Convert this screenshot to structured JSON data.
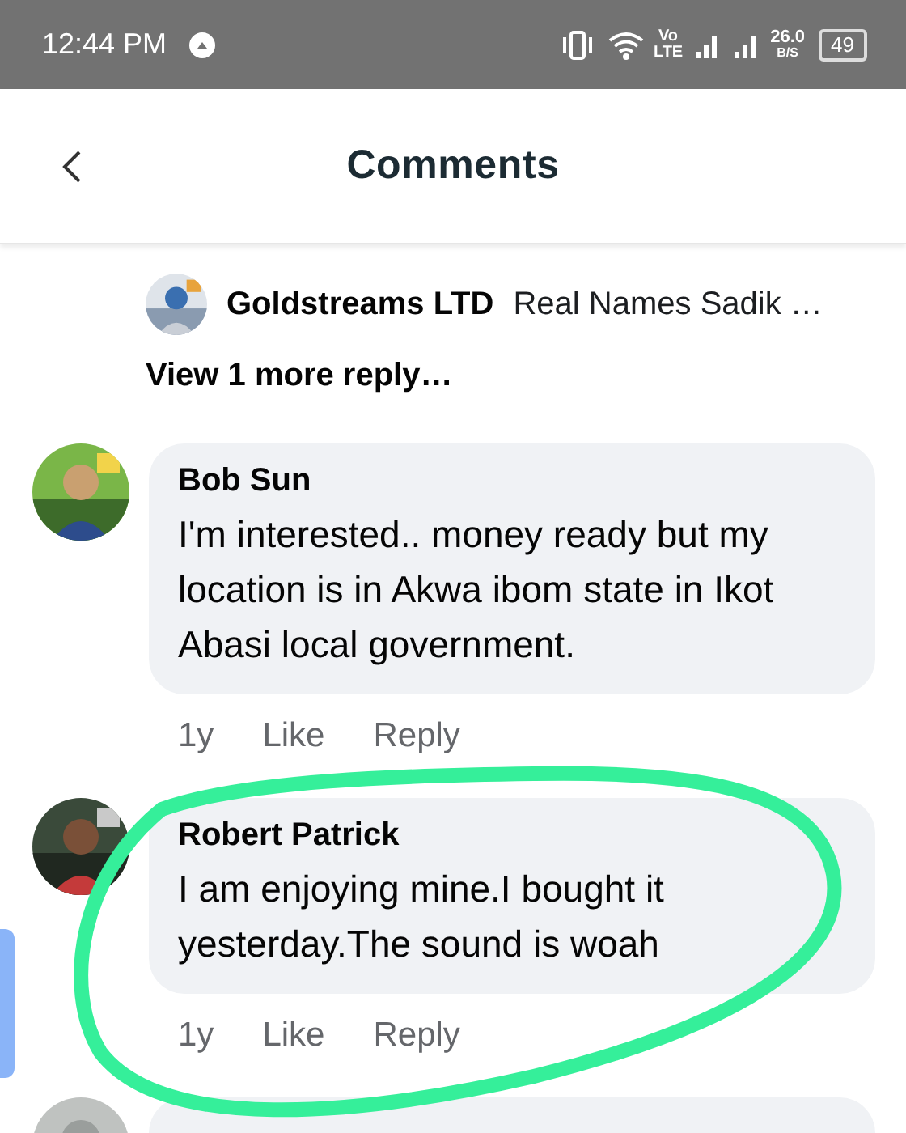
{
  "status_bar": {
    "time": "12:44 PM",
    "volte_top": "Vo",
    "volte_bottom": "LTE",
    "speed": "26.0",
    "speed_unit": "B/S",
    "battery": "49"
  },
  "header": {
    "title": "Comments"
  },
  "thread_reply": {
    "author": "Goldstreams LTD",
    "text": "Real Names Sadik …"
  },
  "view_more": "View 1 more reply…",
  "comments": [
    {
      "author": "Bob Sun",
      "text": "I'm interested.. money ready but my location is in Akwa ibom state in Ikot Abasi local government.",
      "time": "1y",
      "like": "Like",
      "reply": "Reply"
    },
    {
      "author": "Robert Patrick",
      "text": "I am enjoying mine.I bought it yesterday.The sound is woah",
      "time": "1y",
      "like": "Like",
      "reply": "Reply"
    }
  ]
}
